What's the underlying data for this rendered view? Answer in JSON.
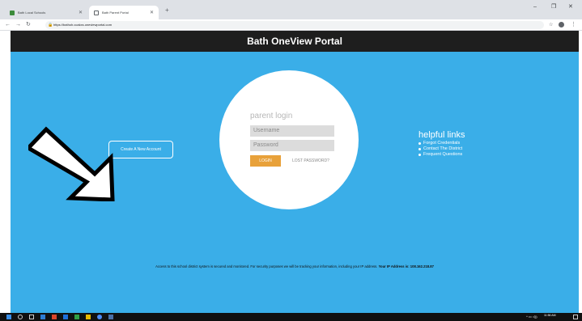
{
  "browser": {
    "tabs": [
      {
        "label": "Bath Local Schools",
        "favicon": "green-school-icon"
      },
      {
        "label": "Bath Parent Portal",
        "favicon": "page-icon"
      }
    ],
    "url": "https://bathoh.ccakxs.oneviewportal.com",
    "window_controls": {
      "minimize": "–",
      "restore": "❐",
      "close": "✕"
    }
  },
  "page": {
    "header_title": "Bath OneView Portal",
    "login": {
      "title": "parent login",
      "username_placeholder": "Username",
      "password_placeholder": "Password",
      "login_button": "LOGIN",
      "lost_password": "LOST PASSWORD?"
    },
    "create_account": "Create A New Account",
    "helpful_links": {
      "title": "helpful links",
      "items": [
        "Forgot Credentials",
        "Contact The District",
        "Frequent Questions"
      ]
    },
    "notice_text": "Access to this school district system is secured and monitored. For security purposes we will be tracking your information, including your IP address.",
    "notice_ip_label": "Your IP Address is: 108.162.218.87"
  },
  "taskbar": {
    "clock_time": "11:56 AM"
  },
  "colors": {
    "header_bg": "#1e1e1e",
    "main_bg": "#3aaee8",
    "login_button": "#e8a13a",
    "field_bg": "#dcdcdc"
  }
}
